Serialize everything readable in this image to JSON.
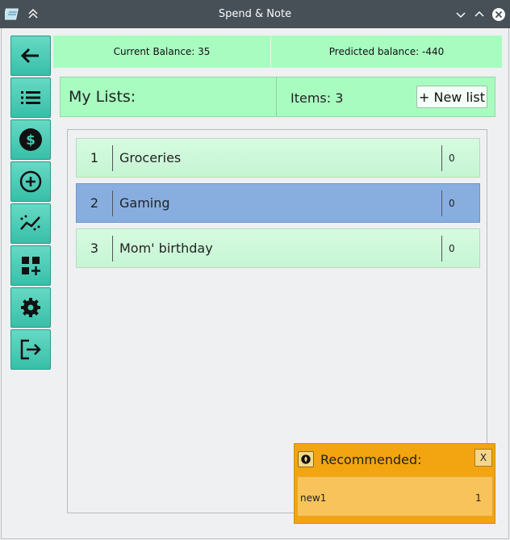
{
  "window": {
    "title": "Spend & Note"
  },
  "sidebar": {
    "buttons": [
      {
        "icon": "arrow-left-icon"
      },
      {
        "icon": "list-icon"
      },
      {
        "icon": "dollar-icon"
      },
      {
        "icon": "plus-circle-icon"
      },
      {
        "icon": "chart-line-icon"
      },
      {
        "icon": "add-widget-icon"
      },
      {
        "icon": "gear-icon"
      },
      {
        "icon": "logout-icon"
      }
    ]
  },
  "balance": {
    "current_label": "Current Balance:  35",
    "predicted_label": "Predicted balance:  -440"
  },
  "lists_header": {
    "title": "My Lists:",
    "items_label": "Items:  3",
    "new_list_label": "+ New list"
  },
  "lists": [
    {
      "num": "1",
      "name": "Groceries",
      "count": "0",
      "selected": false
    },
    {
      "num": "2",
      "name": "Gaming",
      "count": "0",
      "selected": true
    },
    {
      "num": "3",
      "name": "Mom' birthday",
      "count": "0",
      "selected": false
    }
  ],
  "recommended": {
    "title": "Recommended:",
    "close_label": "X",
    "items": [
      {
        "name": "new1",
        "count": "1"
      }
    ]
  },
  "colors": {
    "titlebar": "#475057",
    "accent_green": "#a9fcc0",
    "sidebar_teal": "#44c9b2",
    "selected_row": "#88aee0",
    "recommended_orange": "#f2a510"
  }
}
